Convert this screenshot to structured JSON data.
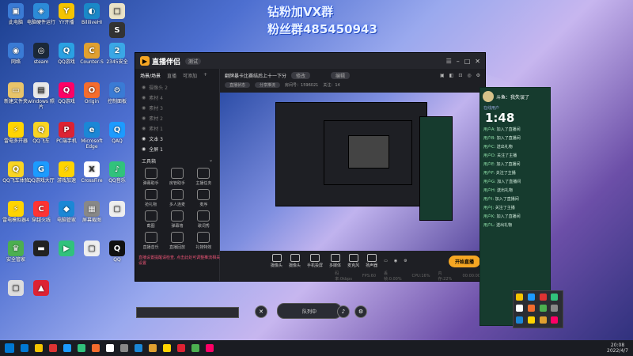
{
  "banner": {
    "line1": "钻粉加VX群",
    "line2": "粉丝群485450943"
  },
  "desktop_icons": [
    {
      "label": "此电脑",
      "color": "#3a7bd5",
      "glyph": "▣"
    },
    {
      "label": "电脑硬件运行",
      "color": "#2c8bd8",
      "glyph": "◈"
    },
    {
      "label": "YY开播",
      "color": "#f5c400",
      "glyph": "Y"
    },
    {
      "label": "BililiveHI",
      "color": "#1a88c8",
      "glyph": "◐"
    },
    {
      "label": "",
      "color": "#e9e2c7",
      "glyph": "□"
    },
    {
      "label": "",
      "color": "#333",
      "glyph": "S"
    },
    {
      "label": "网络",
      "color": "#3a7bd5",
      "glyph": "◉"
    },
    {
      "label": "steam",
      "color": "#1b2838",
      "glyph": "◎"
    },
    {
      "label": "QQ游戏",
      "color": "#2aa1e3",
      "glyph": "Q"
    },
    {
      "label": "Counter-S",
      "color": "#e0a030",
      "glyph": "C"
    },
    {
      "label": "2345安全",
      "color": "#3aa7e6",
      "glyph": "2"
    },
    {
      "label": "回收站",
      "color": "#7d8aa5",
      "glyph": "♻"
    },
    {
      "label": "新建文件夹",
      "color": "#e8c46a",
      "glyph": "▭"
    },
    {
      "label": "windows 照片",
      "color": "#e8e8e8",
      "glyph": "▤"
    },
    {
      "label": "QQ游戏",
      "color": "#f06",
      "glyph": "Q"
    },
    {
      "label": "Origin",
      "color": "#f56c2d",
      "glyph": "O"
    },
    {
      "label": "控制面板",
      "color": "#3a7bd5",
      "glyph": "⚙"
    },
    {
      "label": "WeGame",
      "color": "#ffb000",
      "glyph": "W"
    },
    {
      "label": "雷电多开器",
      "color": "#ffd400",
      "glyph": "⚡"
    },
    {
      "label": "QQ飞车",
      "color": "#f9d423",
      "glyph": "Q"
    },
    {
      "label": "PC端手机",
      "color": "#d23",
      "glyph": "P"
    },
    {
      "label": "Microsoft Edge",
      "color": "#1b87d6",
      "glyph": "e"
    },
    {
      "label": "QAQ",
      "color": "#1c9bff",
      "glyph": "Q"
    },
    {
      "label": "雷电模拟器",
      "color": "#ffd400",
      "glyph": "⚡"
    },
    {
      "label": "QQ飞车体验",
      "color": "#f9d423",
      "glyph": "Q"
    },
    {
      "label": "QQ游戏大厅",
      "color": "#1c9bff",
      "glyph": "G"
    },
    {
      "label": "游戏加速",
      "color": "#ffd400",
      "glyph": "⚡"
    },
    {
      "label": "CrossFire",
      "color": "#fff",
      "glyph": "X"
    },
    {
      "label": "QQ音乐",
      "color": "#31c27c",
      "glyph": "♪"
    },
    {
      "label": "yy",
      "color": "#f5c400",
      "glyph": "Y"
    },
    {
      "label": "雷电模拟器4",
      "color": "#ffd400",
      "glyph": "⚡"
    },
    {
      "label": "穿越火线",
      "color": "#f33",
      "glyph": "C"
    },
    {
      "label": "电脑管家",
      "color": "#1b87d6",
      "glyph": "◆"
    },
    {
      "label": "屏幕截图",
      "color": "#888",
      "glyph": "▦"
    },
    {
      "label": "",
      "color": "#eee",
      "glyph": "▢"
    },
    {
      "label": "",
      "color": "#d33",
      "glyph": "N"
    },
    {
      "label": "安全管家",
      "color": "#4caf50",
      "glyph": "♛"
    },
    {
      "label": "",
      "color": "#222",
      "glyph": "▬"
    },
    {
      "label": "",
      "color": "#31c27c",
      "glyph": "▶"
    },
    {
      "label": "",
      "color": "#eee",
      "glyph": "▢"
    },
    {
      "label": "QQ",
      "color": "#111",
      "glyph": "Q"
    },
    {
      "label": "",
      "color": "#1c6fd8",
      "glyph": "K"
    },
    {
      "label": "",
      "color": "#ddd",
      "glyph": "▢"
    },
    {
      "label": "",
      "color": "#d23",
      "glyph": "▲"
    }
  ],
  "app": {
    "name": "直播伴侣",
    "version": "测试",
    "window_controls": [
      "☰",
      "–",
      "□",
      "✕"
    ],
    "left_tabs": [
      "场景/场景",
      "直播",
      "可添加",
      "+"
    ],
    "scenes": [
      "摄像头 2",
      "素材 4",
      "素材 3",
      "素材 2",
      "素材 1",
      "文本 3",
      "全屏 1"
    ],
    "tools_title": "工具箱",
    "tools": [
      "弹幕助手",
      "房管助手",
      "主播任务",
      "抢礼物",
      "多人连麦",
      "麦序",
      "截图",
      "弹幕墙",
      "歌词秀",
      "直播音乐",
      "直播回放",
      "礼物特效"
    ],
    "title": "翻牌暴卡比赛结后上十一下分",
    "title_pill": "修改",
    "status_pill": "编辑",
    "sub_items": [
      "直播状态",
      "分享推流",
      "房间号：1596021",
      "关注：14"
    ],
    "controls": [
      "摄像头",
      "摄像头",
      "手机投屏",
      "多媒体",
      "麦克风",
      "扬声器"
    ],
    "start_label": "开始直播",
    "status_metrics": [
      "码率:0kbps",
      "FPS:60",
      "丢帧:0.00%",
      "CPU:16%",
      "内存:22%",
      "00:00:00"
    ],
    "notice": "直播设置提醒请检查, 点击此处可调整推流相关设置",
    "dock_label": "队列中"
  },
  "chat": {
    "header": "斗鱼：我失误了",
    "sub": "在线用户",
    "time": "1:48",
    "lines": [
      {
        "n": "用户A",
        "t": "加入了直播间"
      },
      {
        "n": "用户B",
        "t": "加入了直播间"
      },
      {
        "n": "用户C",
        "t": "送出礼物"
      },
      {
        "n": "用户D",
        "t": "关注了主播"
      },
      {
        "n": "用户E",
        "t": "加入了直播间"
      },
      {
        "n": "用户F",
        "t": "关注了主播"
      },
      {
        "n": "用户G",
        "t": "加入了直播间"
      },
      {
        "n": "用户H",
        "t": "送出礼物"
      },
      {
        "n": "用户I",
        "t": "加入了直播间"
      },
      {
        "n": "用户J",
        "t": "关注了主播"
      },
      {
        "n": "用户K",
        "t": "加入了直播间"
      },
      {
        "n": "用户L",
        "t": "送出礼物"
      }
    ]
  },
  "taskbar": {
    "date_time": "20:08",
    "date": "2022/4/7",
    "item_colors": [
      "#0078d4",
      "#f5c400",
      "#d33",
      "#1c9bff",
      "#31c27c",
      "#f56c2d",
      "#fff",
      "#888",
      "#1b87d6",
      "#e0a030",
      "#ffd400",
      "#d23",
      "#4caf50",
      "#f06"
    ]
  }
}
